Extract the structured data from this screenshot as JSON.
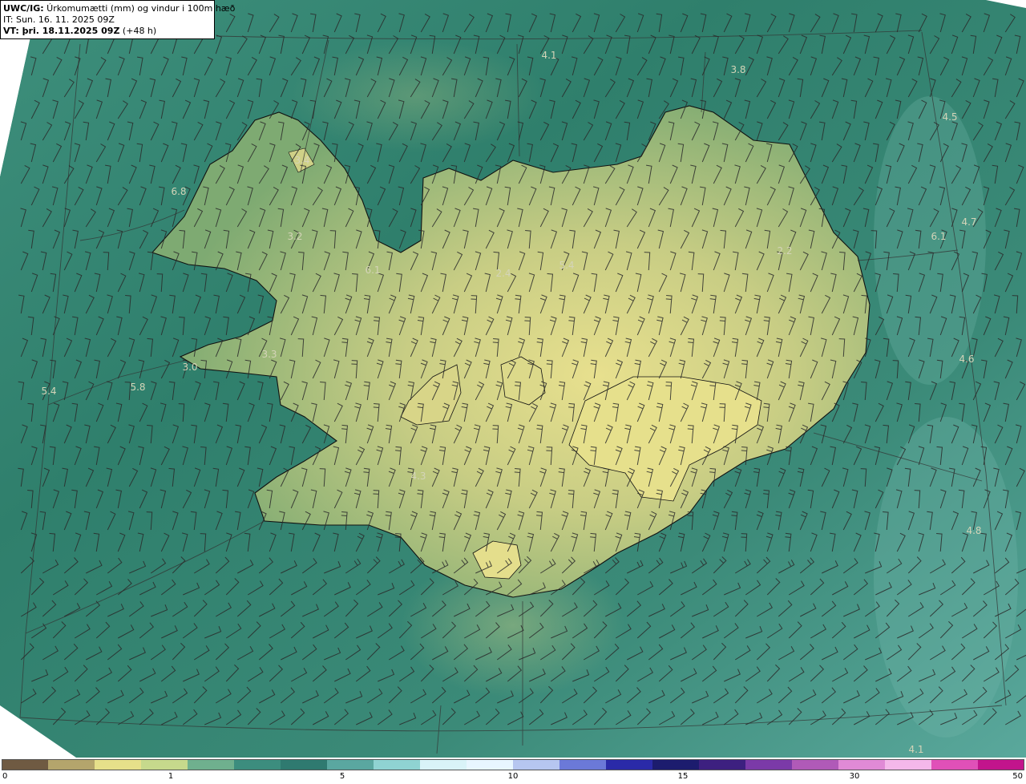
{
  "header": {
    "title_bold": "UWC/IG:",
    "title_rest": " Úrkomumætti (mm) og vindur i 100m hæð",
    "init_time": "IT: Sun. 16. 11. 2025 09Z",
    "valid_bold": "VT: þri. 18.11.2025 09Z",
    "valid_rest": " (+48 h)"
  },
  "colorbar": {
    "labels": [
      "0",
      "1",
      "5",
      "10",
      "15",
      "30",
      "50"
    ],
    "colors": [
      "#6f5a42",
      "#b4a56c",
      "#e6e08a",
      "#c6d98c",
      "#6fb08e",
      "#3c8d7e",
      "#2f7a70",
      "#5aa7a0",
      "#8fd3d2",
      "#d9f3f8",
      "#e8f6ff",
      "#b6c6f0",
      "#6b79d8",
      "#2a2aa8",
      "#1c1c6e",
      "#3d2080",
      "#7b3aa8",
      "#b05ab8",
      "#e08ad6",
      "#f4b8ea",
      "#e050b8",
      "#c2148c"
    ]
  },
  "values": [
    {
      "text": "4.1"
    },
    {
      "text": "3.8"
    },
    {
      "text": "4.5"
    },
    {
      "text": "3.4"
    },
    {
      "text": "6.8"
    },
    {
      "text": "3.2"
    },
    {
      "text": "6.1"
    },
    {
      "text": "2.4"
    },
    {
      "text": "5.4"
    },
    {
      "text": "2.2"
    },
    {
      "text": "4.7"
    },
    {
      "text": "6.1"
    },
    {
      "text": "3.3"
    },
    {
      "text": "3.0"
    },
    {
      "text": "5.4"
    },
    {
      "text": "5.8"
    },
    {
      "text": "4.6"
    },
    {
      "text": "4.3"
    },
    {
      "text": "4.8"
    },
    {
      "text": "4.1"
    }
  ],
  "colors": {
    "sea": "#2f7f6e",
    "sea_light": "#4f9e8e",
    "land_low": "#8fb476",
    "land_high": "#e6df8c",
    "coast": "#111111"
  }
}
